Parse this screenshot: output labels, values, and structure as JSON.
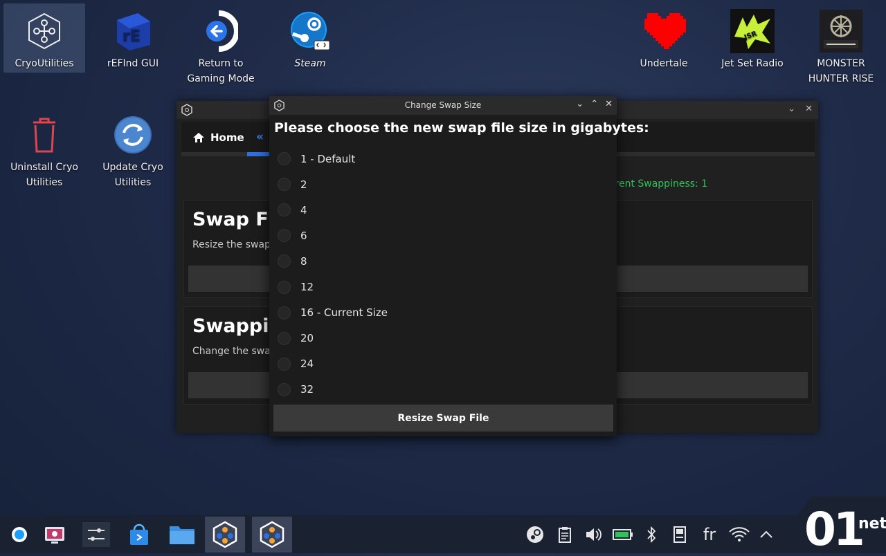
{
  "desktop": {
    "icons": [
      {
        "label": "CryoUtilities",
        "icon": "cryoutilities-icon"
      },
      {
        "label": "rEFInd GUI",
        "icon": "refind-icon"
      },
      {
        "label": "Return to Gaming Mode",
        "icon": "return-gaming-mode-icon"
      },
      {
        "label": "Steam",
        "icon": "steam-icon"
      },
      {
        "label": "Undertale",
        "icon": "undertale-heart-icon"
      },
      {
        "label": "Jet Set Radio",
        "icon": "jet-set-radio-icon"
      },
      {
        "label": "MONSTER HUNTER RISE",
        "icon": "monster-hunter-rise-icon"
      },
      {
        "label": "Uninstall Cryo Utilities",
        "icon": "trash-icon"
      },
      {
        "label": "Update Cryo Utilities",
        "icon": "update-icon"
      }
    ]
  },
  "bg_window": {
    "home_label": "Home",
    "back_glyph": "«",
    "swappiness_text": "rrent Swappiness: 1",
    "cards": [
      {
        "title": "Swap Fil",
        "desc": "Resize the swap"
      },
      {
        "title": "Swappin",
        "desc": "Change the swap"
      }
    ]
  },
  "dialog": {
    "title": "Change Swap Size",
    "prompt": "Please choose the new swap file size in gigabytes:",
    "options": [
      "1 - Default",
      "2",
      "4",
      "6",
      "8",
      "12",
      "16 - Current Size",
      "20",
      "24",
      "32"
    ],
    "button": "Resize Swap File"
  },
  "taskbar": {
    "apps": [
      "steam-deck-icon",
      "screenshot-app-icon",
      "settings-sliders-icon",
      "discover-store-icon",
      "file-manager-icon",
      "cryoutilities-icon",
      "cryoutilities-icon"
    ],
    "tray": [
      "steam-tray-icon",
      "clipboard-icon",
      "volume-icon",
      "battery-icon",
      "bluetooth-icon",
      "storage-icon",
      "fr",
      "wifi-icon",
      "chevron-up-icon"
    ]
  },
  "watermark": {
    "big": "01",
    "small": "net"
  },
  "colors": {
    "accent": "#2f6fe0",
    "green": "#2fc45a",
    "undertale": "#ff0000",
    "jetset": "#c6f03a"
  }
}
